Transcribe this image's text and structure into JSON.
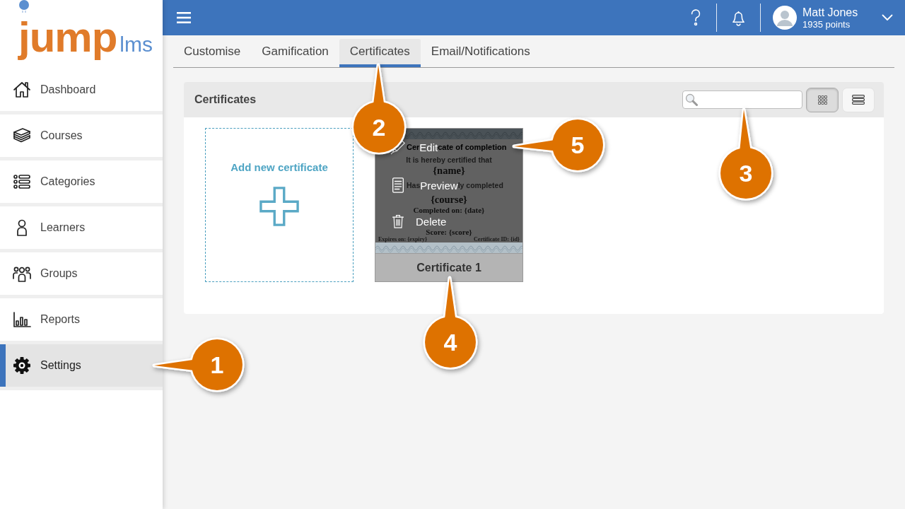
{
  "logo": {
    "primary": "jump",
    "secondary": "lms"
  },
  "sidebar": {
    "items": [
      {
        "label": "Dashboard",
        "selected": false
      },
      {
        "label": "Courses",
        "selected": false
      },
      {
        "label": "Categories",
        "selected": false
      },
      {
        "label": "Learners",
        "selected": false
      },
      {
        "label": "Groups",
        "selected": false
      },
      {
        "label": "Reports",
        "selected": false
      },
      {
        "label": "Settings",
        "selected": true
      }
    ]
  },
  "topbar": {
    "user": {
      "name": "Matt Jones",
      "points": "1935 points"
    }
  },
  "tabs": [
    {
      "label": "Customise",
      "selected": false
    },
    {
      "label": "Gamification",
      "selected": false
    },
    {
      "label": "Certificates",
      "selected": true
    },
    {
      "label": "Email/Notifications",
      "selected": false
    }
  ],
  "panel": {
    "title": "Certificates",
    "view_buttons": [
      {
        "selected": true
      },
      {
        "selected": false
      }
    ],
    "add_card": {
      "label": "Add new certificate"
    },
    "certificates": [
      {
        "name": "Certificate 1",
        "document": {
          "title_parts": [
            "Cer",
            "cate of completion"
          ],
          "intro": "It is hereby certified that",
          "name_token": "{name}",
          "statement_parts": [
            "Has",
            "ly completed"
          ],
          "course_token": "{course}",
          "completed": "Completed on: {date}",
          "score": "Score: {score}",
          "expires": "Expires on: {expiry}",
          "certificate_id": "Certificate ID: {id}"
        },
        "menu": [
          {
            "label": "Edit"
          },
          {
            "label": "Preview"
          },
          {
            "label": "Delete"
          }
        ]
      }
    ]
  },
  "callouts": [
    {
      "label": "1"
    },
    {
      "label": "2"
    },
    {
      "label": "3"
    },
    {
      "label": "4"
    },
    {
      "label": "5"
    }
  ]
}
